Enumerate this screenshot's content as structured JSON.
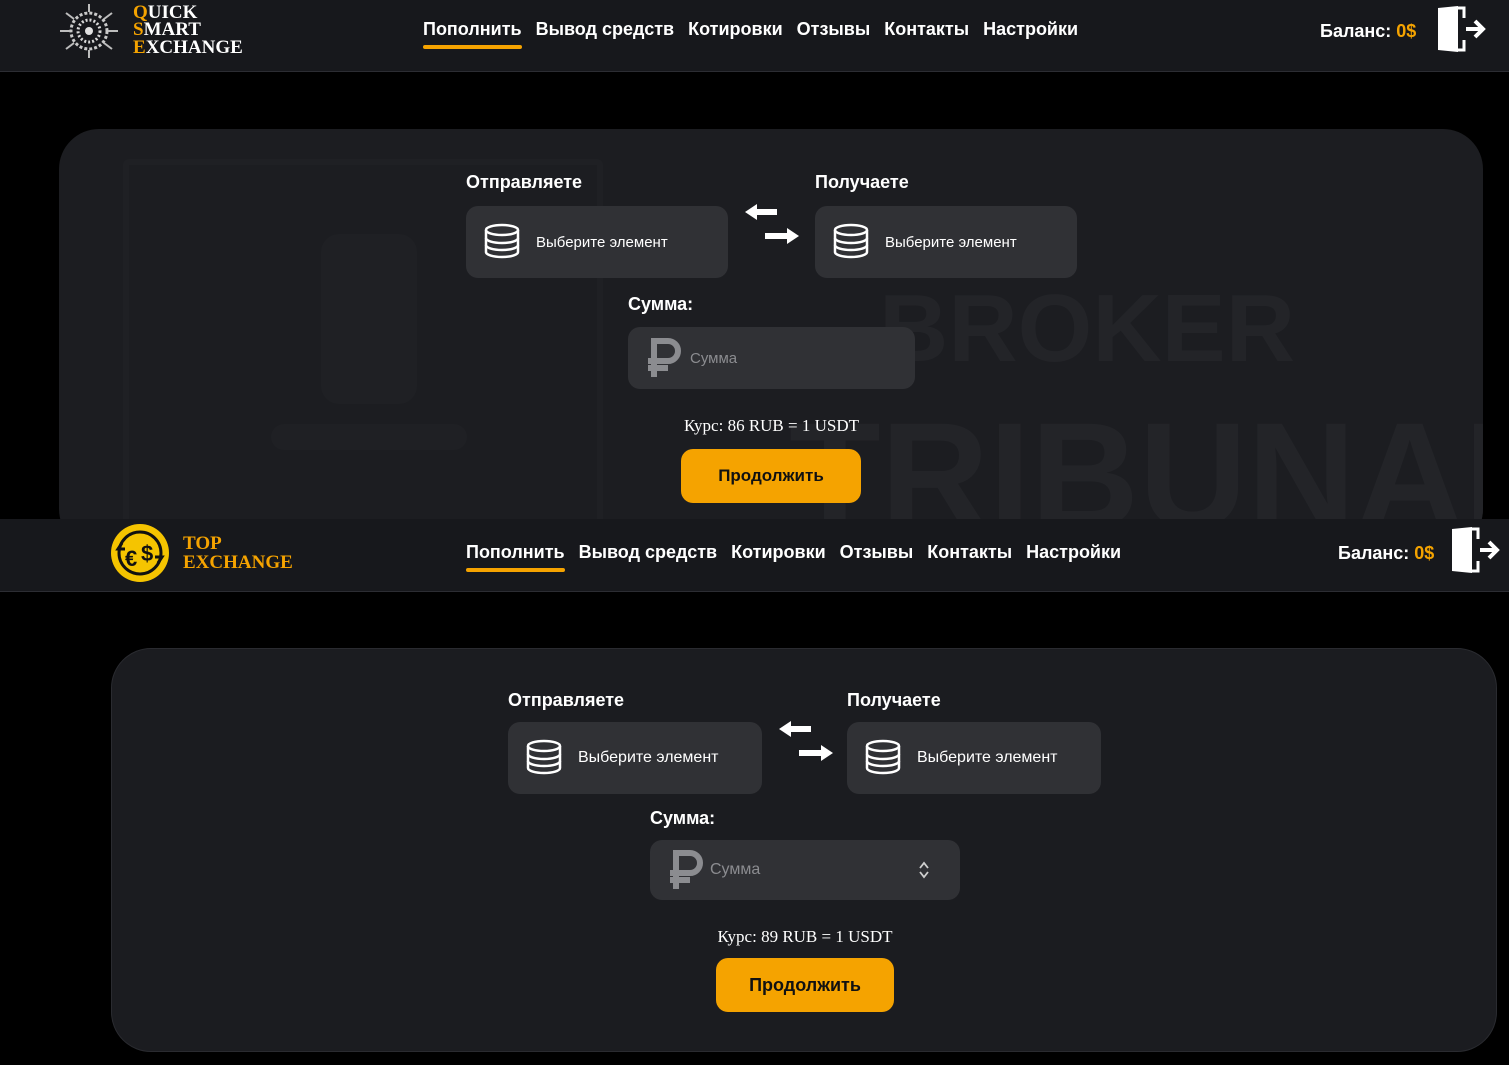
{
  "brand_color": "#f5a300",
  "top_screen": {
    "logo": {
      "line1_cap": "Q",
      "line1_rest": "UICK",
      "line2_cap": "S",
      "line2_rest": "MART",
      "line3_cap": "E",
      "line3_rest": "XCHANGE",
      "icon": "circuit-globe-icon"
    },
    "nav": [
      "Пополнить",
      "Вывод средств",
      "Котировки",
      "Отзывы",
      "Контакты",
      "Настройки"
    ],
    "balance_label": "Баланс:",
    "balance_value": "0$",
    "logout_icon": "logout-door-icon",
    "form": {
      "send_label": "Отправляете",
      "receive_label": "Получаете",
      "send_select": "Выберите элемент",
      "receive_select": "Выберите элемент",
      "amount_label": "Сумма:",
      "amount_placeholder": "Сумма",
      "rate": "Курс: 86 RUB = 1 USDT",
      "continue": "Продолжить"
    },
    "watermark": {
      "line1": "BROKER",
      "line2": "TRIBUNAL"
    }
  },
  "bottom_screen": {
    "logo": {
      "line1": "TOP",
      "line2": "EXCHANGE",
      "icon": "euro-dollar-coin-icon"
    },
    "nav": [
      "Пополнить",
      "Вывод средств",
      "Котировки",
      "Отзывы",
      "Контакты",
      "Настройки"
    ],
    "balance_label": "Баланс:",
    "balance_value": "0$",
    "logout_icon": "logout-door-icon",
    "form": {
      "send_label": "Отправляете",
      "receive_label": "Получаете",
      "send_select": "Выберите элемент",
      "receive_select": "Выберите элемент",
      "amount_label": "Сумма:",
      "amount_placeholder": "Сумма",
      "rate": "Курс: 89 RUB = 1 USDT",
      "continue": "Продолжить"
    }
  }
}
